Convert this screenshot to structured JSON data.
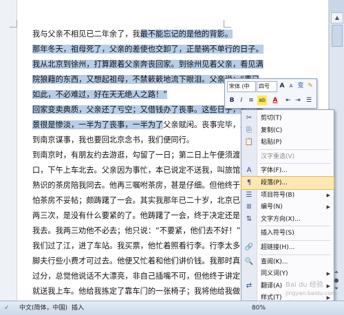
{
  "document": {
    "lines": [
      {
        "pre": "我与父亲不相见已二年余了，我",
        "hl": "最不能忘记的是他的背影。",
        "post": ""
      },
      {
        "pre": "",
        "hl": "那年冬天，祖母死了，父亲的差使也交卸了，正是祸不单行的日子。",
        "post": ""
      },
      {
        "pre": "",
        "hl": "我从北京到徐州，打算跟着父亲奔丧回家。到徐州见着父亲，看见满",
        "post": ""
      },
      {
        "pre": "",
        "hl": "院狼藉的东西，又想起祖母，不禁簌簌地流下眼泪。父亲说：“事已",
        "post": ""
      },
      {
        "pre": "",
        "hl": "如此，不必难过，好在天无绝人之路！”",
        "post": ""
      },
      {
        "pre": "",
        "hl": "回家变卖典质，父亲还了亏空；又借钱办了丧事。这些日子，家中光",
        "post": ""
      },
      {
        "pre": "",
        "hl": "景很是惨淡，一半为了丧事，一半为了",
        "post": "父亲赋闲。丧事完毕，父亲"
      },
      {
        "pre": "到南京谋事，我也要回北京念书，我们便同行。",
        "hl": "",
        "post": ""
      },
      {
        "pre": "到南京时，有朋友约去游逛，勾留了一日；第二日上午便须渡江到浦",
        "hl": "",
        "post": ""
      },
      {
        "pre": "口，下午上车北去。父亲因为事忙，本已说定不送我，叫旅馆里一个",
        "hl": "",
        "post": ""
      },
      {
        "pre": "熟识的茶房陪我同去。他再三嘱咐茶房，甚是仔细。但他终于不放心，",
        "hl": "",
        "post": ""
      },
      {
        "pre": "怕茶房不妥帖；颇踌躇了一会。其实我那年已二十岁，北京已来往过",
        "hl": "",
        "post": ""
      },
      {
        "pre": "两三次，是没有什么要紧的了。他踌躇了一会，终于决定还是自己送",
        "hl": "",
        "post": ""
      },
      {
        "pre": "我去。我两三劝他不必去；他只说：“不要紧，他们去不好！”",
        "hl": "",
        "post": ""
      },
      {
        "pre": "我们过了江，进了车站。我买票，他忙着照看行李。行李太多，得向",
        "hl": "",
        "post": ""
      },
      {
        "pre": "脚夫行些小费才可过去。他便又忙着和他们讲价钱。我那时真是聪明",
        "hl": "",
        "post": ""
      },
      {
        "pre": "过分，总觉他说话不大漂亮，非自己插嘴不可，但他终于讲定了价钱",
        "hl": "",
        "post": ""
      },
      {
        "pre": "就送我上车。他给我拣定了靠车门的一张椅子；我将他给我做的紫毛",
        "hl": "",
        "post": ""
      }
    ]
  },
  "mini_toolbar": {
    "font": "宋体 (中",
    "size": "四号",
    "grow": "A",
    "shrink": "A",
    "wen": "变",
    "brush": "✎",
    "bold": "B",
    "italic": "I",
    "center": "≡",
    "highlight": "ab",
    "fontcolor": "A",
    "indent_dec": "⇤",
    "indent_inc": "⇥",
    "bullets": "☰"
  },
  "context_menu": {
    "items": [
      {
        "icon": "scissors",
        "glyph": "✂",
        "label": "剪切(T)",
        "disabled": false,
        "submenu": false
      },
      {
        "icon": "copy",
        "glyph": "⎘",
        "label": "复制(C)",
        "disabled": false,
        "submenu": false
      },
      {
        "icon": "paste",
        "glyph": "📋",
        "label": "粘贴(P)",
        "disabled": false,
        "submenu": false
      },
      {
        "icon": "",
        "glyph": "",
        "label": "汉字重选(V)",
        "disabled": true,
        "submenu": false
      },
      {
        "icon": "font",
        "glyph": "A",
        "label": "字体(F)...",
        "disabled": false,
        "submenu": false
      },
      {
        "icon": "paragraph",
        "glyph": "¶",
        "label": "段落(P)...",
        "disabled": false,
        "submenu": false,
        "hover": true
      },
      {
        "icon": "bullets",
        "glyph": "☰",
        "label": "项目符号(B)",
        "disabled": false,
        "submenu": true
      },
      {
        "icon": "numbering",
        "glyph": "≣",
        "label": "编号(N)",
        "disabled": false,
        "submenu": true
      },
      {
        "icon": "text-direction",
        "glyph": "⇅",
        "label": "文字方向(X)...",
        "disabled": false,
        "submenu": false
      },
      {
        "icon": "",
        "glyph": "",
        "label": "插入符号(S)",
        "disabled": false,
        "submenu": false
      },
      {
        "icon": "hyperlink",
        "glyph": "🔗",
        "label": "超链接(H)...",
        "disabled": false,
        "submenu": false
      },
      {
        "icon": "lookup",
        "glyph": "🔍",
        "label": "查阅(K)...",
        "disabled": false,
        "submenu": false
      },
      {
        "icon": "",
        "glyph": "",
        "label": "同义词(Y)",
        "disabled": false,
        "submenu": true
      },
      {
        "icon": "translate",
        "glyph": "⇄",
        "label": "翻译(A)",
        "disabled": false,
        "submenu": true
      },
      {
        "icon": "",
        "glyph": "",
        "label": "样式(T)",
        "disabled": false,
        "submenu": true
      }
    ]
  },
  "statusbar": {
    "language": "中文(简体，中国)",
    "insert_mode": "插入",
    "zoom": "80%"
  },
  "watermark": {
    "line1": "Bai du 经验",
    "line2": "jingyan.baidu.com"
  }
}
